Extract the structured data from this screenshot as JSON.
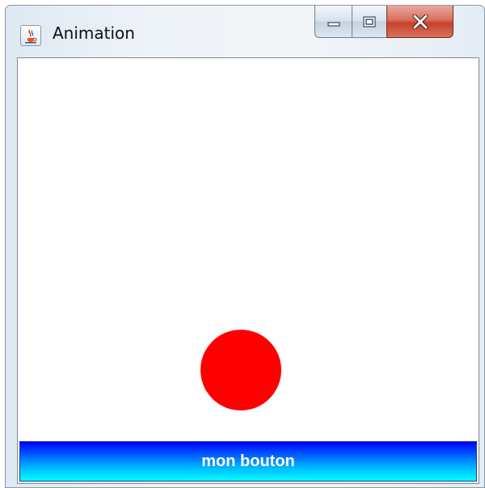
{
  "window": {
    "title": "Animation",
    "app_icon": "java-cup-icon",
    "controls": {
      "minimize_icon": "minimize-icon",
      "maximize_icon": "maximize-icon",
      "close_icon": "close-icon"
    }
  },
  "panel": {
    "ball_color": "#ff0000",
    "background_color": "#ffffff"
  },
  "button": {
    "label": "mon bouton",
    "gradient_top": "#0000ff",
    "gradient_bottom": "#00ffff",
    "text_color": "#ffffff"
  }
}
